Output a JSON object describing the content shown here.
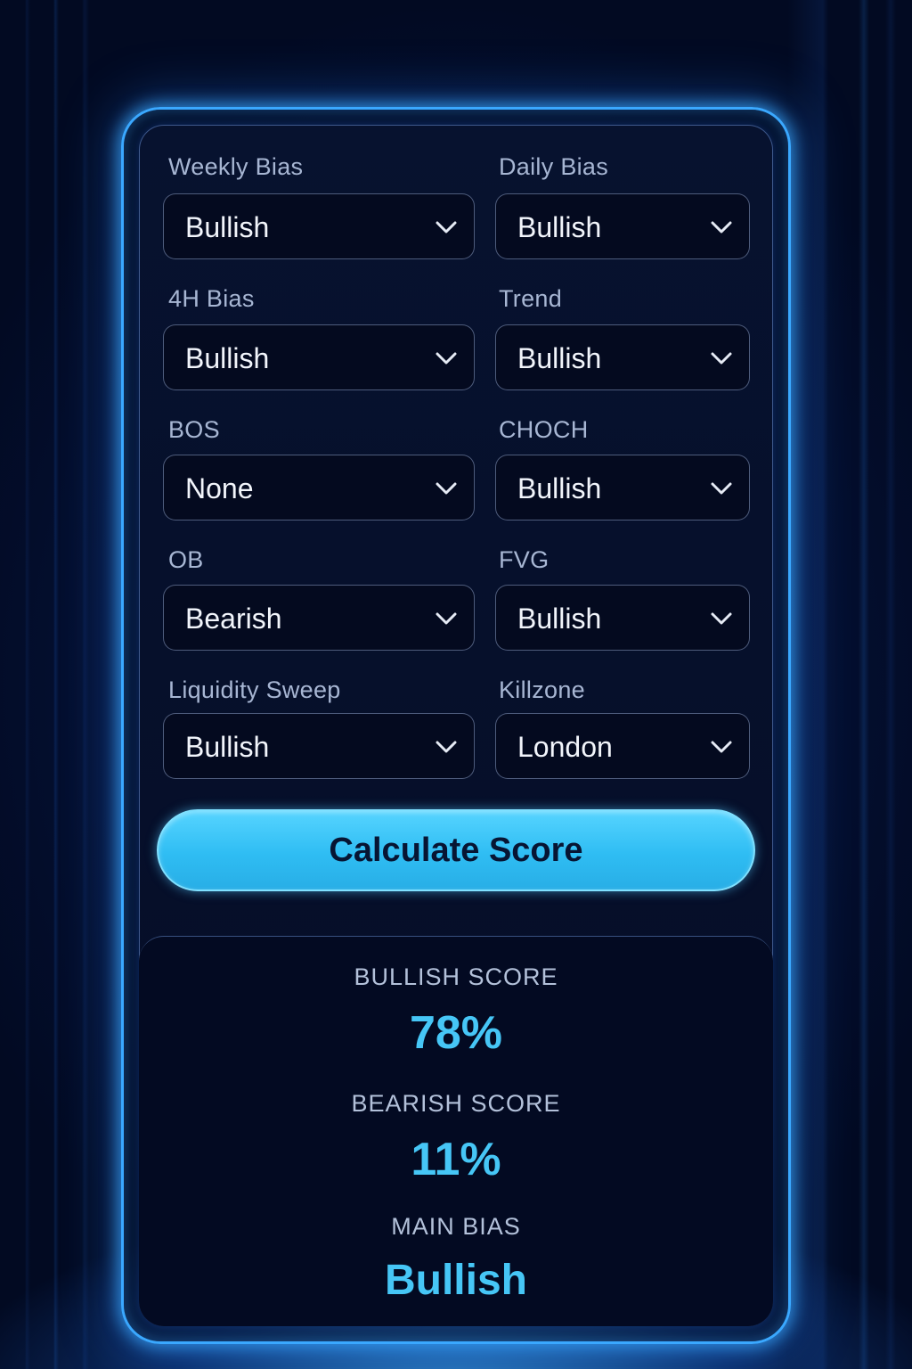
{
  "fields": [
    {
      "label": "Weekly Bias",
      "value": "Bullish"
    },
    {
      "label": "Daily Bias",
      "value": "Bullish"
    },
    {
      "label": "4H Bias",
      "value": "Bullish"
    },
    {
      "label": "Trend",
      "value": "Bullish"
    },
    {
      "label": "BOS",
      "value": "None"
    },
    {
      "label": "CHOCH",
      "value": "Bullish"
    },
    {
      "label": "OB",
      "value": "Bearish"
    },
    {
      "label": "FVG",
      "value": "Bullish"
    },
    {
      "label": "Liquidity Sweep",
      "value": "Bullish"
    },
    {
      "label": "Killzone",
      "value": "London"
    }
  ],
  "button": {
    "label": "Calculate Score"
  },
  "results": {
    "bullish_label": "BULLISH SCORE",
    "bullish_value": "78%",
    "bearish_label": "BEARISH SCORE",
    "bearish_value": "11%",
    "main_label": "MAIN BIAS",
    "main_value": "Bullish"
  },
  "colors": {
    "accent": "#46c6f6",
    "button": "#2fbdf3",
    "frame_glow": "#3aa8ff"
  },
  "icons": {
    "select_chevron": "chevron-down-icon"
  }
}
